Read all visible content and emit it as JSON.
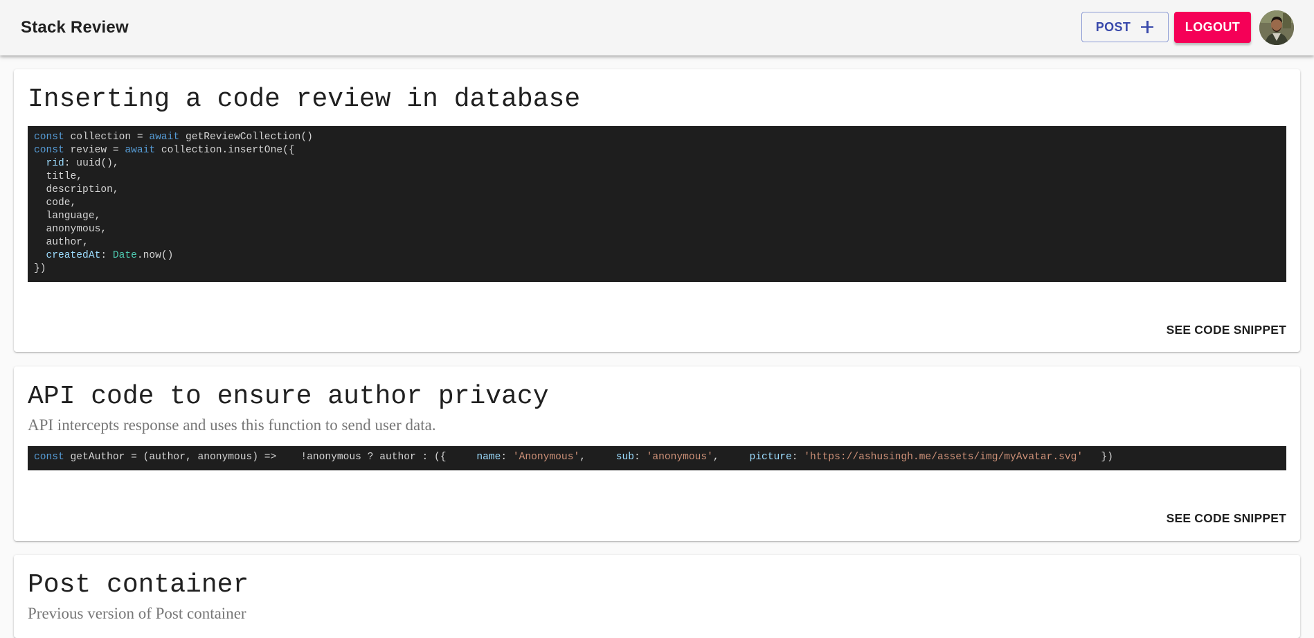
{
  "header": {
    "brand": "Stack Review",
    "post_label": "POST",
    "logout_label": "LOGOUT"
  },
  "colors": {
    "primary": "#3949ab",
    "secondary": "#f50057",
    "code_background": "#1e1e1e"
  },
  "cards": [
    {
      "title": "Inserting a code review in database",
      "code_lines": [
        [
          [
            "kw",
            "const"
          ],
          [
            "",
            " collection = "
          ],
          [
            "kw",
            "await"
          ],
          [
            "",
            " getReviewCollection()"
          ]
        ],
        [
          [
            "kw",
            "const"
          ],
          [
            "",
            " review = "
          ],
          [
            "kw",
            "await"
          ],
          [
            "",
            " collection.insertOne({"
          ]
        ],
        [
          [
            "",
            "  "
          ],
          [
            "prop",
            "rid"
          ],
          [
            "",
            ": uuid(),"
          ]
        ],
        [
          [
            "",
            "  title,"
          ]
        ],
        [
          [
            "",
            "  description,"
          ]
        ],
        [
          [
            "",
            "  code,"
          ]
        ],
        [
          [
            "",
            "  language,"
          ]
        ],
        [
          [
            "",
            "  anonymous,"
          ]
        ],
        [
          [
            "",
            "  author,"
          ]
        ],
        [
          [
            "",
            "  "
          ],
          [
            "prop",
            "createdAt"
          ],
          [
            "",
            ": "
          ],
          [
            "type",
            "Date"
          ],
          [
            "",
            ".now()"
          ]
        ],
        [
          [
            "",
            "})"
          ]
        ]
      ],
      "action_label": "SEE CODE SNIPPET"
    },
    {
      "title": "API code to ensure author privacy",
      "description": "API intercepts response and uses this function to send user data.",
      "code_lines": [
        [
          [
            "kw",
            "const"
          ],
          [
            "",
            " getAuthor = (author, anonymous) =>    !anonymous ? author : ({     "
          ],
          [
            "prop",
            "name"
          ],
          [
            "",
            ": "
          ],
          [
            "str",
            "'Anonymous'"
          ],
          [
            "",
            ",     "
          ],
          [
            "prop",
            "sub"
          ],
          [
            "",
            ": "
          ],
          [
            "str",
            "'anonymous'"
          ],
          [
            "",
            ",     "
          ],
          [
            "prop",
            "picture"
          ],
          [
            "",
            ": "
          ],
          [
            "str",
            "'https://ashusingh.me/assets/img/myAvatar.svg'"
          ],
          [
            "",
            "   })"
          ]
        ]
      ],
      "action_label": "SEE CODE SNIPPET"
    },
    {
      "title": "Post container",
      "description": "Previous version of Post container"
    }
  ]
}
